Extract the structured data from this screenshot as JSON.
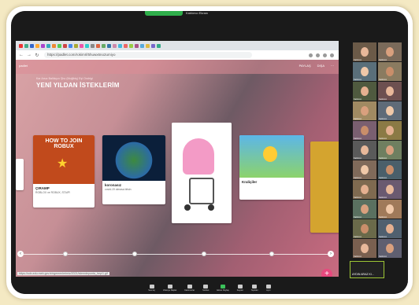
{
  "zoom": {
    "share_label": "Katılımcı Ekranı"
  },
  "browser": {
    "url": "https://padlet.com/rokimrl/5huwx6no2umiyo",
    "status_url": "https://cdn.edu.meb.gov.tr/egemenlerimiz/2021/islemdepunta_hep/1.gif"
  },
  "padlet": {
    "label": "padlet",
    "author": "Kar Arsız Ballıkçızı Şhu (Moğlbiş) Eşl Ondrigi",
    "title": "YENİ YILDAN İSTEKLERİM",
    "actions": [
      "PAYLAŞ",
      "DIŞA",
      "⋯"
    ],
    "cards": [
      {
        "title": "ÇIRAMP",
        "sub": "ROBLOX ve ROBUX, STAIP!"
      },
      {
        "title": "koronasız",
        "sub": "covid-19 olmasa bitsin"
      },
      {
        "title": "",
        "sub": ""
      },
      {
        "title": "Kraliçiler",
        "sub": ""
      }
    ],
    "card_img_text": "HOW TO JOIN ROBUX"
  },
  "gallery": {
    "speaker_name": "AYDIN ARAZ KI...",
    "participants": [
      "Katılımcı",
      "Katılımcı",
      "Katılımcı",
      "Katılımcı",
      "Katılımcı",
      "Katılımcı",
      "Katılımcı",
      "Katılımcı",
      "Katılımcı",
      "Katılımcı",
      "Katılımcı",
      "Katılımcı",
      "Katılımcı",
      "Katılımcı",
      "Katılımcı",
      "Katılımcı",
      "Katılımcı",
      "Katılımcı",
      "Katılımcı",
      "Katılımcı",
      "Katılımcı",
      "Katılımcı"
    ]
  },
  "toolbar": [
    "Sesi Aç",
    "Videoyu Başlat",
    "Katılımcılar",
    "Sohbet",
    "Ekran Paylaş",
    "Kaydet",
    "Tepkiler",
    "Ayrıl"
  ]
}
